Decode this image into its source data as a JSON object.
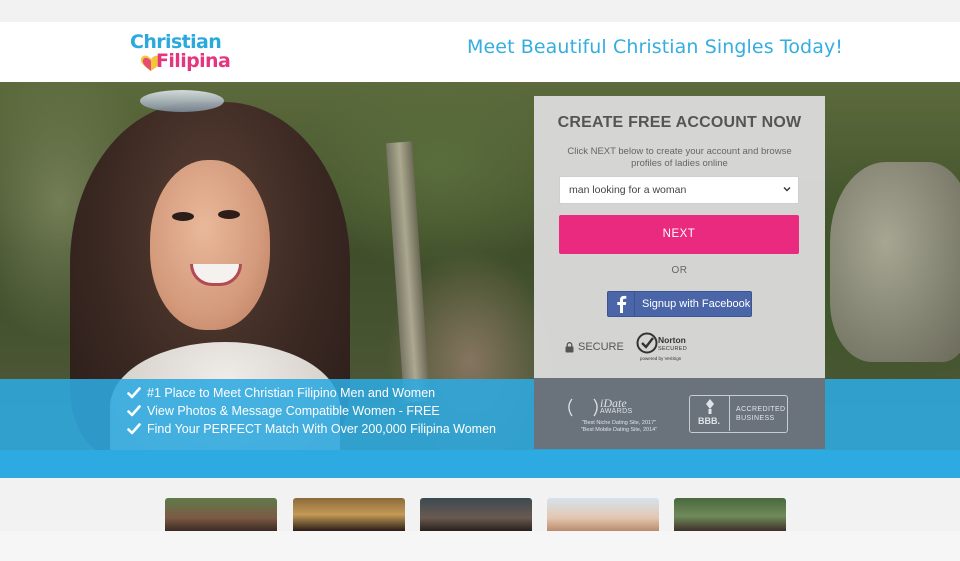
{
  "header": {
    "logo_line1": "Christian",
    "logo_line2": "Filipina",
    "tagline": "Meet Beautiful Christian Singles Today!"
  },
  "signup": {
    "title": "CREATE FREE ACCOUNT NOW",
    "subtitle": "Click NEXT below to create your account and browse profiles of ladies online",
    "select_value": "man looking for a woman",
    "next_label": "NEXT",
    "or_label": "OR",
    "facebook_label": "Signup with Facebook",
    "secure_label": "SECURE",
    "norton_title": "Norton",
    "norton_sub": "SECURED",
    "norton_powered": "powered by VeriSign"
  },
  "awards": {
    "idate_title": "iDate",
    "idate_sub": "AWARDS",
    "idate_line1": "\"Best Niche Dating Site, 2017\"",
    "idate_line2": "\"Best Mobile Dating Site, 2014\"",
    "bbb_label": "BBB.",
    "bbb_line1": "ACCREDITED",
    "bbb_line2": "BUSINESS"
  },
  "features": [
    "#1 Place to Meet Christian Filipino Men and Women",
    "View Photos & Message Compatible Women - FREE",
    "Find Your PERFECT Match With Over 200,000 Filipina Women"
  ],
  "colors": {
    "brand_blue": "#2eaae2",
    "brand_pink": "#ea2a7f",
    "facebook_blue": "#4a66a8"
  },
  "profile_thumbs": [
    "profile-photo-1",
    "profile-photo-2",
    "profile-photo-3",
    "profile-photo-4",
    "profile-photo-5"
  ]
}
